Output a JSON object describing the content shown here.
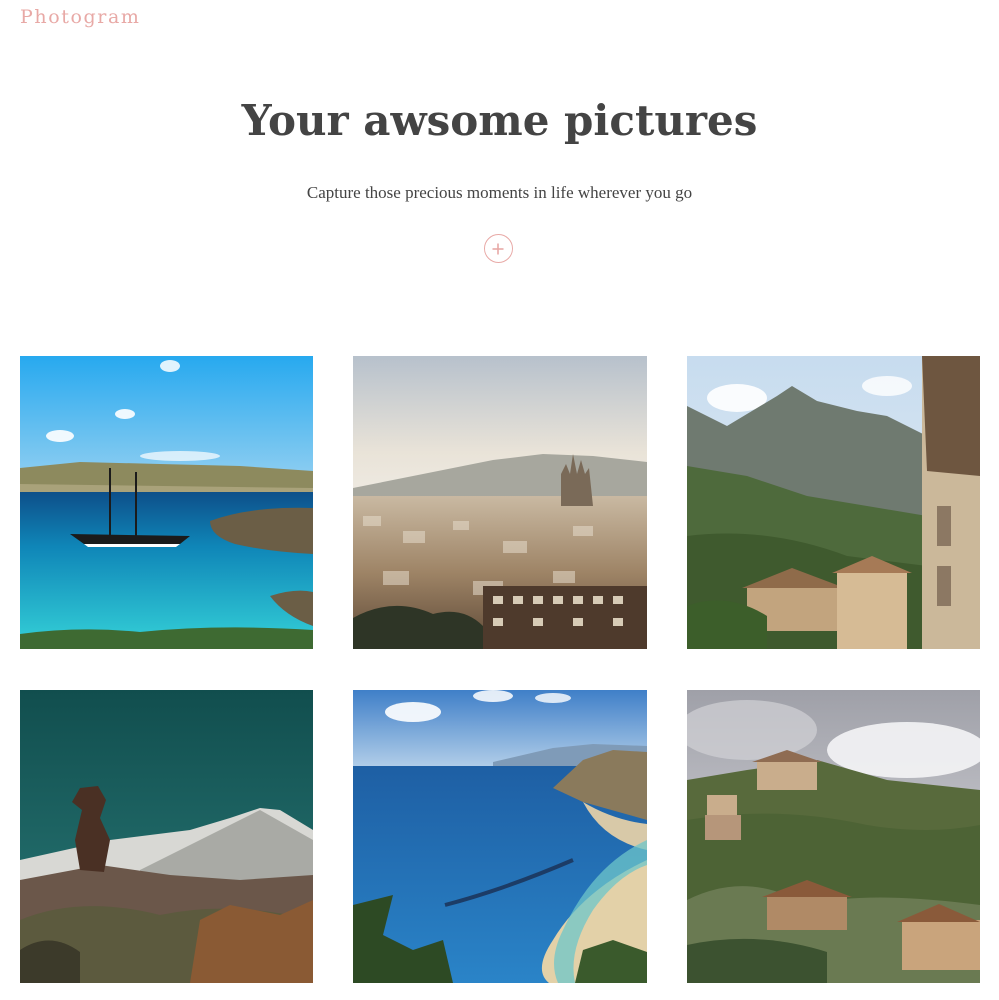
{
  "header": {
    "brand": "Photogram"
  },
  "hero": {
    "title": "Your awsome pictures",
    "subtitle": "Capture those precious moments in life wherever you go",
    "add_button_icon": "plus-icon"
  },
  "gallery": {
    "photos": [
      {
        "subject": "sailboat in turquoise bay"
      },
      {
        "subject": "city skyline with cathedral"
      },
      {
        "subject": "mountain village street"
      },
      {
        "subject": "rock pillar and snowy volcano"
      },
      {
        "subject": "curved beach coastline"
      },
      {
        "subject": "hillside village in clouds"
      }
    ]
  },
  "colors": {
    "accent": "#e8a9a6",
    "text": "#444444",
    "background": "#ffffff"
  }
}
